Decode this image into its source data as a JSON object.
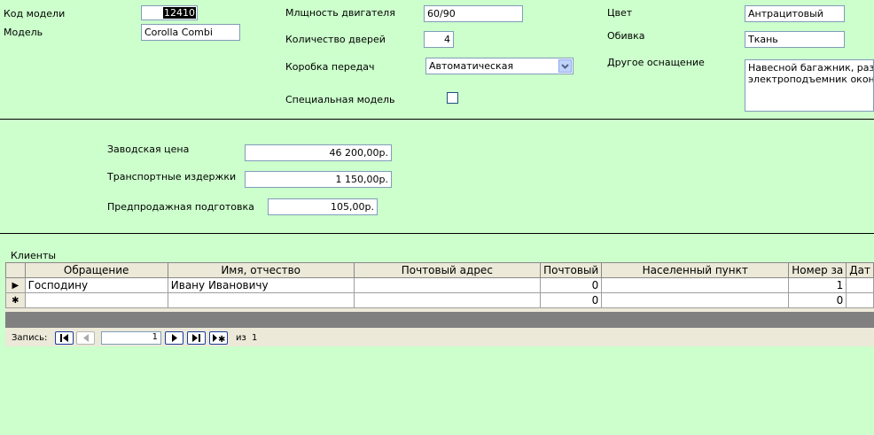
{
  "fields": {
    "model_code": {
      "label": "Код модели",
      "value": "12410"
    },
    "model": {
      "label": "Модель",
      "value": "Corolla Combi"
    },
    "engine_power": {
      "label": "Млщность двигателя",
      "value": "60/90"
    },
    "doors": {
      "label": "Количество дверей",
      "value": "4"
    },
    "gearbox": {
      "label": "Коробка передач",
      "value": "Автоматическая"
    },
    "special_model": {
      "label": "Специальная модель",
      "checked": false
    },
    "color": {
      "label": "Цвет",
      "value": "Антрацитовый"
    },
    "upholstery": {
      "label": "Обивка",
      "value": "Ткань"
    },
    "other_equipment": {
      "label": "Другое оснащение",
      "lines": [
        "Навесной багажник, разде",
        "электроподъемник окон"
      ]
    }
  },
  "prices": {
    "factory": {
      "label": "Заводская цена",
      "value": "46 200,00р."
    },
    "transport": {
      "label": "Транспортные издержки",
      "value": "1 150,00р."
    },
    "presale": {
      "label": "Предпродажная подготовка",
      "value": "105,00р."
    }
  },
  "clients": {
    "label": "Клиенты",
    "columns": [
      "Обращение",
      "Имя, отчество",
      "Почтовый адрес",
      "Почтовый",
      "Населенный пункт",
      "Номер за",
      "Дат"
    ],
    "rows": [
      {
        "selector": "▶",
        "cells": [
          "Господину",
          "Ивану Ивановичу",
          "",
          "0",
          "",
          "1",
          ""
        ]
      },
      {
        "selector": "✱",
        "cells": [
          "",
          "",
          "",
          "0",
          "",
          "0",
          ""
        ]
      }
    ],
    "nav": {
      "record_label": "Запись:",
      "current": "1",
      "of_label": "из",
      "total": "1"
    }
  }
}
